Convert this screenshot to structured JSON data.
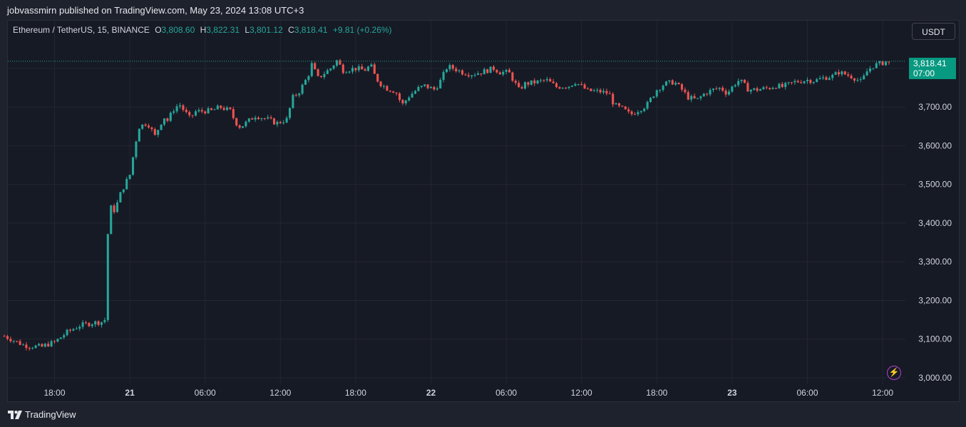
{
  "header": {
    "published_text": "jobvassmirn published on TradingView.com, May 23, 2024 13:08 UTC+3"
  },
  "legend": {
    "symbol": "Ethereum / TetherUS, 15, BINANCE",
    "open_label": "O",
    "open_value": "3,808.60",
    "high_label": "H",
    "high_value": "3,822.31",
    "low_label": "L",
    "low_value": "3,801.12",
    "close_label": "C",
    "close_value": "3,818.41",
    "change": "+9.81 (+0.26%)"
  },
  "currency_button": "USDT",
  "price_tag": {
    "price": "3,818.41",
    "countdown": "07:00"
  },
  "footer": {
    "brand": "TradingView"
  },
  "colors": {
    "up": "#26a69a",
    "down": "#ef5350",
    "background": "#161a25",
    "grid": "#232632",
    "price_tag": "#089981"
  },
  "icons": [
    "tradingview-logo-icon",
    "lightning-bolt-icon"
  ],
  "chart_data": {
    "type": "candlestick",
    "symbol": "ETHUSDT",
    "interval_minutes": 15,
    "last_price": 3818.41,
    "ylim": [
      3000,
      3860
    ],
    "y_ticks": [
      "3,000.00",
      "3,100.00",
      "3,200.00",
      "3,300.00",
      "3,400.00",
      "3,500.00",
      "3,600.00",
      "3,700.00"
    ],
    "y_tick_values": [
      3000,
      3100,
      3200,
      3300,
      3400,
      3500,
      3600,
      3700
    ],
    "x_ticks": [
      {
        "label": "18:00",
        "hours": 18,
        "bold": false
      },
      {
        "label": "21",
        "hours": 24,
        "bold": true
      },
      {
        "label": "06:00",
        "hours": 30,
        "bold": false
      },
      {
        "label": "12:00",
        "hours": 36,
        "bold": false
      },
      {
        "label": "18:00",
        "hours": 42,
        "bold": false
      },
      {
        "label": "22",
        "hours": 48,
        "bold": true
      },
      {
        "label": "06:00",
        "hours": 54,
        "bold": false
      },
      {
        "label": "12:00",
        "hours": 60,
        "bold": false
      },
      {
        "label": "18:00",
        "hours": 66,
        "bold": false
      },
      {
        "label": "23",
        "hours": 72,
        "bold": true
      },
      {
        "label": "06:00",
        "hours": 78,
        "bold": false
      },
      {
        "label": "12:00",
        "hours": 84,
        "bold": false
      }
    ],
    "close_path": [
      [
        14.0,
        3108
      ],
      [
        15.5,
        3085
      ],
      [
        16.0,
        3082
      ],
      [
        17.0,
        3080
      ],
      [
        17.3,
        3085
      ],
      [
        18.0,
        3092
      ],
      [
        19.0,
        3118
      ],
      [
        20.0,
        3135
      ],
      [
        21.0,
        3142
      ],
      [
        21.8,
        3145
      ],
      [
        22.0,
        3150
      ],
      [
        22.15,
        3345
      ],
      [
        22.5,
        3440
      ],
      [
        22.8,
        3432
      ],
      [
        23.3,
        3480
      ],
      [
        23.6,
        3500
      ],
      [
        24.0,
        3525
      ],
      [
        24.4,
        3598
      ],
      [
        24.7,
        3648
      ],
      [
        25.4,
        3660
      ],
      [
        26.0,
        3625
      ],
      [
        26.7,
        3675
      ],
      [
        27.0,
        3665
      ],
      [
        27.6,
        3700
      ],
      [
        28.0,
        3705
      ],
      [
        28.8,
        3670
      ],
      [
        29.2,
        3688
      ],
      [
        30.0,
        3690
      ],
      [
        30.5,
        3690
      ],
      [
        31.2,
        3700
      ],
      [
        32.0,
        3690
      ],
      [
        32.4,
        3662
      ],
      [
        32.8,
        3648
      ],
      [
        33.3,
        3660
      ],
      [
        34.0,
        3678
      ],
      [
        35.0,
        3668
      ],
      [
        35.7,
        3658
      ],
      [
        36.5,
        3668
      ],
      [
        37.0,
        3725
      ],
      [
        37.5,
        3740
      ],
      [
        38.2,
        3780
      ],
      [
        38.5,
        3810
      ],
      [
        39.0,
        3775
      ],
      [
        40.0,
        3800
      ],
      [
        40.5,
        3820
      ],
      [
        41.0,
        3795
      ],
      [
        42.0,
        3800
      ],
      [
        42.7,
        3795
      ],
      [
        43.2,
        3808
      ],
      [
        43.6,
        3775
      ],
      [
        44.0,
        3760
      ],
      [
        44.5,
        3748
      ],
      [
        45.2,
        3740
      ],
      [
        45.7,
        3705
      ],
      [
        46.3,
        3730
      ],
      [
        47.0,
        3748
      ],
      [
        47.5,
        3755
      ],
      [
        48.3,
        3745
      ],
      [
        48.8,
        3770
      ],
      [
        49.3,
        3805
      ],
      [
        49.8,
        3800
      ],
      [
        50.5,
        3790
      ],
      [
        51.2,
        3785
      ],
      [
        52.0,
        3790
      ],
      [
        53.0,
        3800
      ],
      [
        53.5,
        3790
      ],
      [
        54.2,
        3790
      ],
      [
        55.0,
        3745
      ],
      [
        55.5,
        3760
      ],
      [
        56.5,
        3765
      ],
      [
        57.2,
        3770
      ],
      [
        58.0,
        3752
      ],
      [
        59.0,
        3755
      ],
      [
        59.5,
        3765
      ],
      [
        60.5,
        3742
      ],
      [
        61.5,
        3740
      ],
      [
        62.2,
        3735
      ],
      [
        62.6,
        3705
      ],
      [
        63.3,
        3695
      ],
      [
        63.9,
        3680
      ],
      [
        64.4,
        3690
      ],
      [
        65.2,
        3705
      ],
      [
        66.0,
        3745
      ],
      [
        66.6,
        3760
      ],
      [
        67.4,
        3765
      ],
      [
        68.0,
        3745
      ],
      [
        68.5,
        3725
      ],
      [
        69.2,
        3718
      ],
      [
        69.8,
        3735
      ],
      [
        70.5,
        3745
      ],
      [
        71.1,
        3750
      ],
      [
        71.6,
        3735
      ],
      [
        72.2,
        3760
      ],
      [
        72.6,
        3770
      ],
      [
        73.3,
        3745
      ],
      [
        74.0,
        3745
      ],
      [
        75.0,
        3750
      ],
      [
        75.5,
        3755
      ],
      [
        76.0,
        3752
      ],
      [
        77.0,
        3765
      ],
      [
        78.0,
        3770
      ],
      [
        78.6,
        3768
      ],
      [
        79.2,
        3775
      ],
      [
        80.0,
        3780
      ],
      [
        80.5,
        3790
      ],
      [
        81.0,
        3785
      ],
      [
        81.6,
        3778
      ],
      [
        82.3,
        3765
      ],
      [
        82.8,
        3795
      ],
      [
        83.3,
        3808
      ],
      [
        83.8,
        3812
      ],
      [
        84.3,
        3818
      ],
      [
        84.7,
        3808
      ]
    ]
  }
}
